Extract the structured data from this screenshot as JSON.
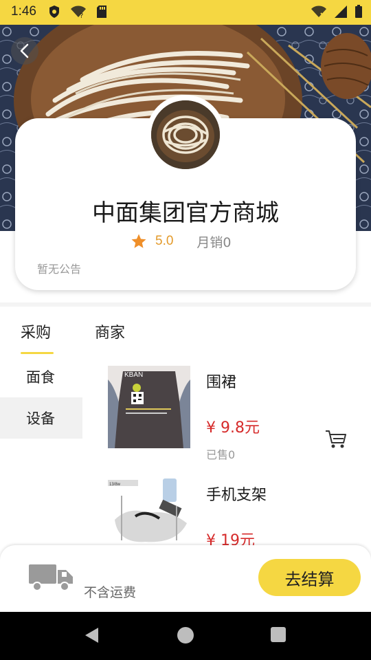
{
  "status_bar": {
    "time": "1:46",
    "left_icons": [
      "shield-icon",
      "wifi-unknown-icon",
      "sd-card-icon"
    ],
    "right_icons": [
      "wifi-off-icon",
      "signal-icon",
      "battery-icon"
    ]
  },
  "header": {
    "back_icon": "chevron-left-icon"
  },
  "store": {
    "name": "中面集团官方商城",
    "rating": "5.0",
    "monthly_sales": "月销0",
    "announcement": "暂无公告"
  },
  "tabs": [
    {
      "label": "采购",
      "active": true
    },
    {
      "label": "商家",
      "active": false
    }
  ],
  "categories": [
    {
      "label": "面食",
      "selected": false
    },
    {
      "label": "设备",
      "selected": true
    }
  ],
  "products": [
    {
      "name": "围裙",
      "price": "¥ 9.8元",
      "sold": "已售0"
    },
    {
      "name": "手机支架",
      "price": "¥ 19元",
      "sold": ""
    }
  ],
  "bottom_bar": {
    "shipping_note": "不含运费",
    "checkout_label": "去结算"
  },
  "colors": {
    "accent": "#f5d742",
    "price": "#d62b2b",
    "rating": "#e39a2a"
  }
}
